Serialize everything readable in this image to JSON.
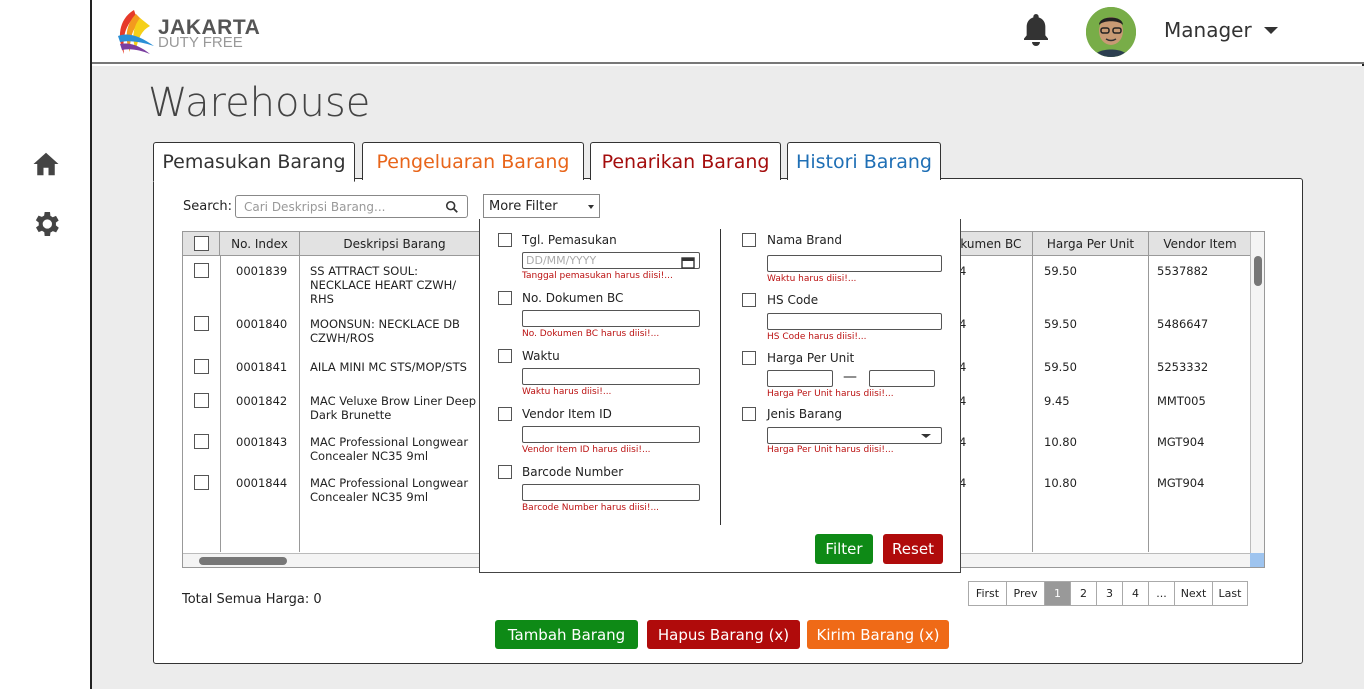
{
  "brand": {
    "line1": "JAKARTA",
    "line2": "DUTY FREE"
  },
  "user": {
    "name": "Manager"
  },
  "page_title": "Warehouse",
  "tabs": [
    {
      "label": "Pemasukan Barang",
      "color": "#333333"
    },
    {
      "label": "Pengeluaran Barang",
      "color": "#e8651a"
    },
    {
      "label": "Penarikan Barang",
      "color": "#a40d0d"
    },
    {
      "label": "Histori Barang",
      "color": "#1f6fb5"
    }
  ],
  "search": {
    "label": "Search:",
    "placeholder": "Cari Deskripsi Barang..."
  },
  "more_filter": {
    "label": "More Filter"
  },
  "table": {
    "columns": [
      "No. Index",
      "Deskripsi Barang",
      "okumen BC",
      "Harga Per Unit",
      "Vendor Item"
    ],
    "rows": [
      {
        "index": "0001839",
        "desc": "SS ATTRACT SOUL: NECKLACE HEART CZWH/ RHS",
        "bc": "4",
        "price": "59.50",
        "vendor": "5537882"
      },
      {
        "index": "0001840",
        "desc": "MOONSUN: NECKLACE DB CZWH/ROS",
        "bc": "4",
        "price": "59.50",
        "vendor": "5486647"
      },
      {
        "index": "0001841",
        "desc": "AILA MINI MC STS/MOP/STS",
        "bc": "4",
        "price": "59.50",
        "vendor": "5253332"
      },
      {
        "index": "0001842",
        "desc": "MAC Veluxe Brow Liner Deep Dark Brunette",
        "bc": "4",
        "price": "9.45",
        "vendor": "MMT005"
      },
      {
        "index": "0001843",
        "desc": "MAC Professional Longwear Concealer NC35 9ml",
        "bc": "4",
        "price": "10.80",
        "vendor": "MGT904"
      },
      {
        "index": "0001844",
        "desc": "MAC Professional Longwear Concealer NC35 9ml",
        "bc": "4",
        "price": "10.80",
        "vendor": "MGT904"
      }
    ]
  },
  "filter": {
    "left": [
      {
        "label": "Tgl. Pemasukan",
        "placeholder": "DD/MM/YYYY",
        "error": "Tanggal pemasukan harus diisi!..."
      },
      {
        "label": "No. Dokumen BC",
        "placeholder": "",
        "error": "No. Dokumen BC harus diisi!..."
      },
      {
        "label": "Waktu",
        "placeholder": "",
        "error": "Waktu harus diisi!..."
      },
      {
        "label": "Vendor Item ID",
        "placeholder": "",
        "error": "Vendor Item ID harus diisi!..."
      },
      {
        "label": "Barcode Number",
        "placeholder": "",
        "error": "Barcode Number harus diisi!..."
      }
    ],
    "right": [
      {
        "label": "Nama Brand",
        "error": "Waktu harus diisi!..."
      },
      {
        "label": "HS Code",
        "error": "HS Code harus diisi!..."
      },
      {
        "label": "Harga Per Unit",
        "error": "Harga Per Unit harus diisi!..."
      },
      {
        "label": "Jenis Barang",
        "error": "Harga Per Unit harus diisi!..."
      }
    ],
    "filter_btn": "Filter",
    "reset_btn": "Reset",
    "range_sep": "—"
  },
  "total": "Total Semua Harga: 0",
  "pagination": [
    "First",
    "Prev",
    "1",
    "2",
    "3",
    "4",
    "...",
    "Next",
    "Last"
  ],
  "actions": {
    "add": "Tambah Barang",
    "delete": "Hapus Barang (x)",
    "send": "Kirim Barang (x)"
  },
  "colors": {
    "green": "#0e8a16",
    "red": "#b00b0b",
    "orange": "#ef6a17",
    "active_page": "#999999"
  },
  "icons": [
    "home-icon",
    "gear-icon",
    "bell-icon",
    "search-icon",
    "calendar-icon",
    "caret-down-icon"
  ]
}
